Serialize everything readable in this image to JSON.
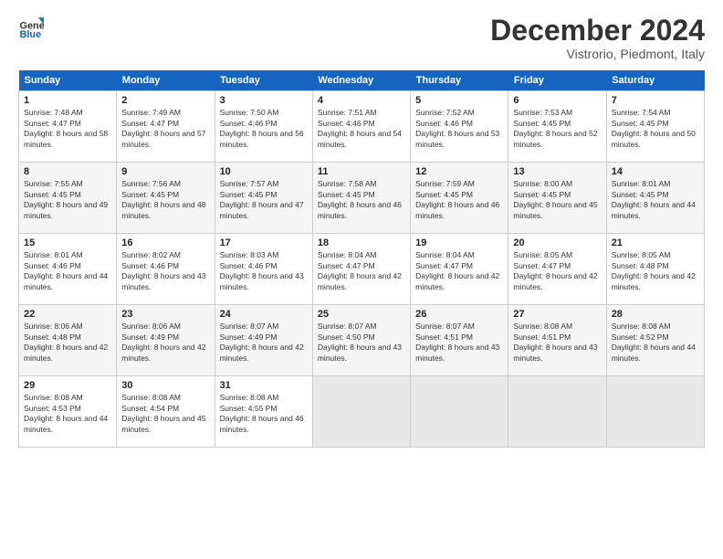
{
  "logo": {
    "line1": "General",
    "line2": "Blue"
  },
  "title": "December 2024",
  "subtitle": "Vistrorio, Piedmont, Italy",
  "days_header": [
    "Sunday",
    "Monday",
    "Tuesday",
    "Wednesday",
    "Thursday",
    "Friday",
    "Saturday"
  ],
  "weeks": [
    [
      {
        "day": "1",
        "sunrise": "Sunrise: 7:48 AM",
        "sunset": "Sunset: 4:47 PM",
        "daylight": "Daylight: 8 hours and 58 minutes."
      },
      {
        "day": "2",
        "sunrise": "Sunrise: 7:49 AM",
        "sunset": "Sunset: 4:47 PM",
        "daylight": "Daylight: 8 hours and 57 minutes."
      },
      {
        "day": "3",
        "sunrise": "Sunrise: 7:50 AM",
        "sunset": "Sunset: 4:46 PM",
        "daylight": "Daylight: 8 hours and 56 minutes."
      },
      {
        "day": "4",
        "sunrise": "Sunrise: 7:51 AM",
        "sunset": "Sunset: 4:46 PM",
        "daylight": "Daylight: 8 hours and 54 minutes."
      },
      {
        "day": "5",
        "sunrise": "Sunrise: 7:52 AM",
        "sunset": "Sunset: 4:46 PM",
        "daylight": "Daylight: 8 hours and 53 minutes."
      },
      {
        "day": "6",
        "sunrise": "Sunrise: 7:53 AM",
        "sunset": "Sunset: 4:45 PM",
        "daylight": "Daylight: 8 hours and 52 minutes."
      },
      {
        "day": "7",
        "sunrise": "Sunrise: 7:54 AM",
        "sunset": "Sunset: 4:45 PM",
        "daylight": "Daylight: 8 hours and 50 minutes."
      }
    ],
    [
      {
        "day": "8",
        "sunrise": "Sunrise: 7:55 AM",
        "sunset": "Sunset: 4:45 PM",
        "daylight": "Daylight: 8 hours and 49 minutes."
      },
      {
        "day": "9",
        "sunrise": "Sunrise: 7:56 AM",
        "sunset": "Sunset: 4:45 PM",
        "daylight": "Daylight: 8 hours and 48 minutes."
      },
      {
        "day": "10",
        "sunrise": "Sunrise: 7:57 AM",
        "sunset": "Sunset: 4:45 PM",
        "daylight": "Daylight: 8 hours and 47 minutes."
      },
      {
        "day": "11",
        "sunrise": "Sunrise: 7:58 AM",
        "sunset": "Sunset: 4:45 PM",
        "daylight": "Daylight: 8 hours and 46 minutes."
      },
      {
        "day": "12",
        "sunrise": "Sunrise: 7:59 AM",
        "sunset": "Sunset: 4:45 PM",
        "daylight": "Daylight: 8 hours and 46 minutes."
      },
      {
        "day": "13",
        "sunrise": "Sunrise: 8:00 AM",
        "sunset": "Sunset: 4:45 PM",
        "daylight": "Daylight: 8 hours and 45 minutes."
      },
      {
        "day": "14",
        "sunrise": "Sunrise: 8:01 AM",
        "sunset": "Sunset: 4:45 PM",
        "daylight": "Daylight: 8 hours and 44 minutes."
      }
    ],
    [
      {
        "day": "15",
        "sunrise": "Sunrise: 8:01 AM",
        "sunset": "Sunset: 4:46 PM",
        "daylight": "Daylight: 8 hours and 44 minutes."
      },
      {
        "day": "16",
        "sunrise": "Sunrise: 8:02 AM",
        "sunset": "Sunset: 4:46 PM",
        "daylight": "Daylight: 8 hours and 43 minutes."
      },
      {
        "day": "17",
        "sunrise": "Sunrise: 8:03 AM",
        "sunset": "Sunset: 4:46 PM",
        "daylight": "Daylight: 8 hours and 43 minutes."
      },
      {
        "day": "18",
        "sunrise": "Sunrise: 8:04 AM",
        "sunset": "Sunset: 4:47 PM",
        "daylight": "Daylight: 8 hours and 42 minutes."
      },
      {
        "day": "19",
        "sunrise": "Sunrise: 8:04 AM",
        "sunset": "Sunset: 4:47 PM",
        "daylight": "Daylight: 8 hours and 42 minutes."
      },
      {
        "day": "20",
        "sunrise": "Sunrise: 8:05 AM",
        "sunset": "Sunset: 4:47 PM",
        "daylight": "Daylight: 8 hours and 42 minutes."
      },
      {
        "day": "21",
        "sunrise": "Sunrise: 8:05 AM",
        "sunset": "Sunset: 4:48 PM",
        "daylight": "Daylight: 8 hours and 42 minutes."
      }
    ],
    [
      {
        "day": "22",
        "sunrise": "Sunrise: 8:06 AM",
        "sunset": "Sunset: 4:48 PM",
        "daylight": "Daylight: 8 hours and 42 minutes."
      },
      {
        "day": "23",
        "sunrise": "Sunrise: 8:06 AM",
        "sunset": "Sunset: 4:49 PM",
        "daylight": "Daylight: 8 hours and 42 minutes."
      },
      {
        "day": "24",
        "sunrise": "Sunrise: 8:07 AM",
        "sunset": "Sunset: 4:49 PM",
        "daylight": "Daylight: 8 hours and 42 minutes."
      },
      {
        "day": "25",
        "sunrise": "Sunrise: 8:07 AM",
        "sunset": "Sunset: 4:50 PM",
        "daylight": "Daylight: 8 hours and 43 minutes."
      },
      {
        "day": "26",
        "sunrise": "Sunrise: 8:07 AM",
        "sunset": "Sunset: 4:51 PM",
        "daylight": "Daylight: 8 hours and 43 minutes."
      },
      {
        "day": "27",
        "sunrise": "Sunrise: 8:08 AM",
        "sunset": "Sunset: 4:51 PM",
        "daylight": "Daylight: 8 hours and 43 minutes."
      },
      {
        "day": "28",
        "sunrise": "Sunrise: 8:08 AM",
        "sunset": "Sunset: 4:52 PM",
        "daylight": "Daylight: 8 hours and 44 minutes."
      }
    ],
    [
      {
        "day": "29",
        "sunrise": "Sunrise: 8:08 AM",
        "sunset": "Sunset: 4:53 PM",
        "daylight": "Daylight: 8 hours and 44 minutes."
      },
      {
        "day": "30",
        "sunrise": "Sunrise: 8:08 AM",
        "sunset": "Sunset: 4:54 PM",
        "daylight": "Daylight: 8 hours and 45 minutes."
      },
      {
        "day": "31",
        "sunrise": "Sunrise: 8:08 AM",
        "sunset": "Sunset: 4:55 PM",
        "daylight": "Daylight: 8 hours and 46 minutes."
      },
      null,
      null,
      null,
      null
    ]
  ]
}
